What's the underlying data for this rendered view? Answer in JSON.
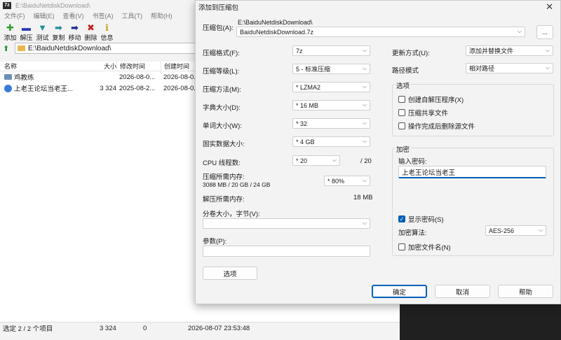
{
  "fm": {
    "title": "E:\\BaiduNetdiskDownload\\",
    "logo": "7z",
    "menu": [
      "文件(F)",
      "编辑(E)",
      "查看(V)",
      "书签(A)",
      "工具(T)",
      "帮助(H)"
    ],
    "toolbar": [
      {
        "label": "添加",
        "glyph": "✚",
        "color": "#2e9e2e"
      },
      {
        "label": "解压",
        "glyph": "▬",
        "color": "#2a3fb5"
      },
      {
        "label": "测试",
        "glyph": "▼",
        "color": "#1f8f9c"
      },
      {
        "label": "复制",
        "glyph": "➡",
        "color": "#1f8f9c"
      },
      {
        "label": "移动",
        "glyph": "➡",
        "color": "#1f2f8f"
      },
      {
        "label": "删除",
        "glyph": "✖",
        "color": "#c81e1e"
      },
      {
        "label": "信息",
        "glyph": "ℹ",
        "color": "#c8a21e"
      }
    ],
    "address": "E:\\BaiduNetdiskDownload\\",
    "columns": {
      "name": "名称",
      "size": "大小",
      "modified": "修改时间",
      "created": "创建时间"
    },
    "rows": [
      {
        "name": "鸡教练",
        "size": "",
        "modified": "2026-08-0...",
        "created": "2026-08-0..."
      },
      {
        "name": "上老王论坛当老王...",
        "size": "3 324",
        "modified": "2025-08-2...",
        "created": "2026-08-0..."
      }
    ],
    "status": {
      "selected": "选定 2 / 2 个项目",
      "size": "3 324",
      "count": "0",
      "time": "2026-08-07 23:53:48"
    }
  },
  "dlg": {
    "title": "添加到压缩包",
    "archive_label": "压缩包(A):",
    "archive_path": "E:\\BaiduNetdiskDownload\\",
    "archive_name": "BaiduNetdiskDownload.7z",
    "browse": "...",
    "format_label": "压缩格式(F):",
    "format": "7z",
    "level_label": "压缩等级(L):",
    "level": "5 - 标准压缩",
    "method_label": "压缩方法(M):",
    "method": "* LZMA2",
    "dict_label": "字典大小(D):",
    "dict": "* 16 MB",
    "word_label": "单词大小(W):",
    "word": "* 32",
    "solid_label": "固实数据大小:",
    "solid": "* 4 GB",
    "cpu_label": "CPU 线程数:",
    "cpu": "* 20",
    "cpu_max": "/ 20",
    "mem_comp_label": "压缩所需内存:",
    "mem_comp_detail": "3088 MB / 20 GB / 24 GB",
    "mem_comp_pct": "* 80%",
    "mem_decomp_label": "解压所需内存:",
    "mem_decomp": "18 MB",
    "volume_label": "分卷大小，字节(V):",
    "params_label": "参数(P):",
    "options_btn": "选项",
    "update_label": "更新方式(U):",
    "update": "添加并替换文件",
    "pathmode_label": "路径模式",
    "pathmode": "相对路径",
    "options_group": "选项",
    "opt_sfx": "创建自解压程序(X)",
    "opt_shared": "压缩共享文件",
    "opt_delete": "操作完成后删除源文件",
    "enc_group": "加密",
    "enc_pwd_label": "输入密码:",
    "enc_pwd": "上老王论坛当老王",
    "enc_show": "显示密码(S)",
    "enc_method_label": "加密算法:",
    "enc_method": "AES-256",
    "enc_names": "加密文件名(N)",
    "ok": "确定",
    "cancel": "取消",
    "help": "帮助",
    "close": "✕"
  }
}
